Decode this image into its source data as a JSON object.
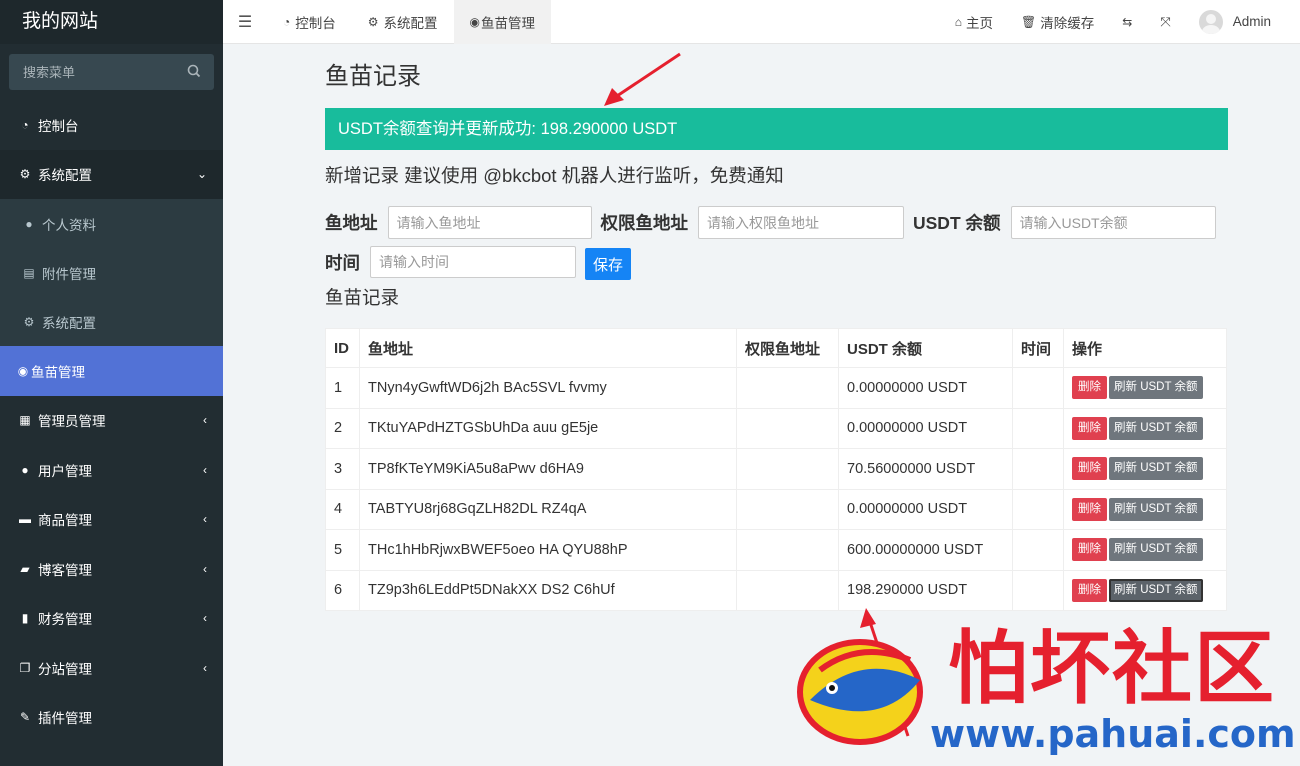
{
  "sidebar": {
    "logo": "我的网站",
    "search_placeholder": "搜索菜单",
    "items": [
      {
        "label": "控制台",
        "icon": "dashboard-icon"
      },
      {
        "label": "系统配置",
        "icon": "cogs-icon",
        "open": true
      },
      {
        "label": "个人资料",
        "icon": "user-icon"
      },
      {
        "label": "附件管理",
        "icon": "file-icon"
      },
      {
        "label": "系统配置",
        "icon": "gear-icon"
      },
      {
        "label": "鱼苗管理",
        "icon": "eye-icon",
        "active": true
      },
      {
        "label": "管理员管理",
        "icon": "windows-icon"
      },
      {
        "label": "用户管理",
        "icon": "user-icon"
      },
      {
        "label": "商品管理",
        "icon": "cart-icon"
      },
      {
        "label": "博客管理",
        "icon": "book-icon"
      },
      {
        "label": "财务管理",
        "icon": "bookmark-icon"
      },
      {
        "label": "分站管理",
        "icon": "clone-icon"
      },
      {
        "label": "插件管理",
        "icon": "wrench-icon"
      }
    ]
  },
  "navbar": {
    "tabs": [
      {
        "label": "控制台",
        "icon": "dashboard-icon"
      },
      {
        "label": "系统配置",
        "icon": "gear-icon"
      },
      {
        "label": "鱼苗管理",
        "icon": "eye-icon",
        "active": true
      }
    ],
    "home": "主页",
    "clear_cache": "清除缓存",
    "user": "Admin"
  },
  "page": {
    "title": "鱼苗记录",
    "alert": "USDT余额查询并更新成功: 198.290000 USDT",
    "hint": "新增记录 建议使用 @bkcbot 机器人进行监听，免费通知",
    "form": {
      "addr_label": "鱼地址",
      "addr_placeholder": "请输入鱼地址",
      "perm_label": "权限鱼地址",
      "perm_placeholder": "请输入权限鱼地址",
      "usdt_label": "USDT 余额",
      "usdt_placeholder": "请输入USDT余额",
      "time_label": "时间",
      "time_placeholder": "请输入时间",
      "save": "保存"
    },
    "section_title": "鱼苗记录"
  },
  "table": {
    "headers": [
      "ID",
      "鱼地址",
      "权限鱼地址",
      "USDT 余额",
      "时间",
      "操作"
    ],
    "delete_label": "删除",
    "refresh_label": "刷新 USDT 余额",
    "rows": [
      {
        "id": "1",
        "addr": "TNyn4yGwftWD6j2h BAc5SVL fvvmy",
        "perm": "",
        "usdt": "0.00000000 USDT",
        "time": ""
      },
      {
        "id": "2",
        "addr": "TKtuYAPdHZTGSbUhDa auu gE5je",
        "perm": "",
        "usdt": "0.00000000 USDT",
        "time": ""
      },
      {
        "id": "3",
        "addr": "TP8fKTeYM9KiA5u8aPwv d6HA9",
        "perm": "",
        "usdt": "70.56000000 USDT",
        "time": ""
      },
      {
        "id": "4",
        "addr": "TABTYU8rj68GqZLH82DL RZ4qA",
        "perm": "",
        "usdt": "0.00000000 USDT",
        "time": ""
      },
      {
        "id": "5",
        "addr": "THc1hHbRjwxBWEF5oeo HA QYU88hP",
        "perm": "",
        "usdt": "600.00000000 USDT",
        "time": ""
      },
      {
        "id": "6",
        "addr": "TZ9p3h6LEddPt5DNakXX DS2 C6hUf",
        "perm": "",
        "usdt": "198.290000 USDT",
        "time": ""
      }
    ]
  },
  "watermark": {
    "text": "怕坏社区",
    "url": "www.pahuai.com"
  }
}
